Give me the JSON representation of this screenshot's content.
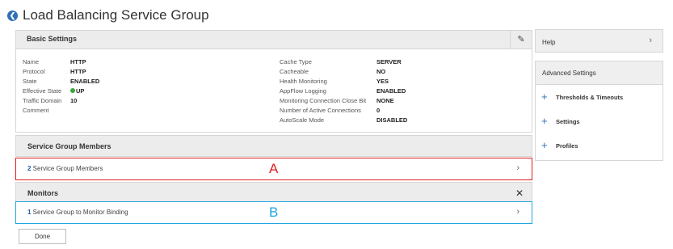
{
  "page": {
    "title": "Load Balancing Service Group"
  },
  "basic_settings": {
    "title": "Basic Settings",
    "left": [
      {
        "key": "Name",
        "value": "HTTP"
      },
      {
        "key": "Protocol",
        "value": "HTTP"
      },
      {
        "key": "State",
        "value": "ENABLED"
      },
      {
        "key": "Effective State",
        "value": "UP"
      },
      {
        "key": "Traffic Domain",
        "value": "10"
      },
      {
        "key": "Comment",
        "value": ""
      }
    ],
    "right": [
      {
        "key": "Cache Type",
        "value": "SERVER"
      },
      {
        "key": "Cacheable",
        "value": "NO"
      },
      {
        "key": "Health Monitoring",
        "value": "YES"
      },
      {
        "key": "AppFlow Logging",
        "value": "ENABLED"
      },
      {
        "key": "Monitoring Connection Close Bit",
        "value": "NONE"
      },
      {
        "key": "Number of Active Connections",
        "value": "0"
      },
      {
        "key": "AutoScale Mode",
        "value": "DISABLED"
      }
    ]
  },
  "members": {
    "title": "Service Group Members",
    "count": "2",
    "link_label": " Service Group Members",
    "annotation": "A"
  },
  "monitors": {
    "title": "Monitors",
    "count": "1",
    "link_label": " Service Group to Monitor Binding",
    "annotation": "B"
  },
  "done_label": "Done",
  "sidebar": {
    "help_label": "Help",
    "advanced_title": "Advanced Settings",
    "items": [
      {
        "label": "Thresholds & Timeouts"
      },
      {
        "label": "Settings"
      },
      {
        "label": "Profiles"
      }
    ]
  },
  "colors": {
    "annotation_a": "#e11d1d",
    "annotation_b": "#1ea6e0",
    "accent": "#2f6fb5",
    "status_up": "#3aa63a"
  }
}
